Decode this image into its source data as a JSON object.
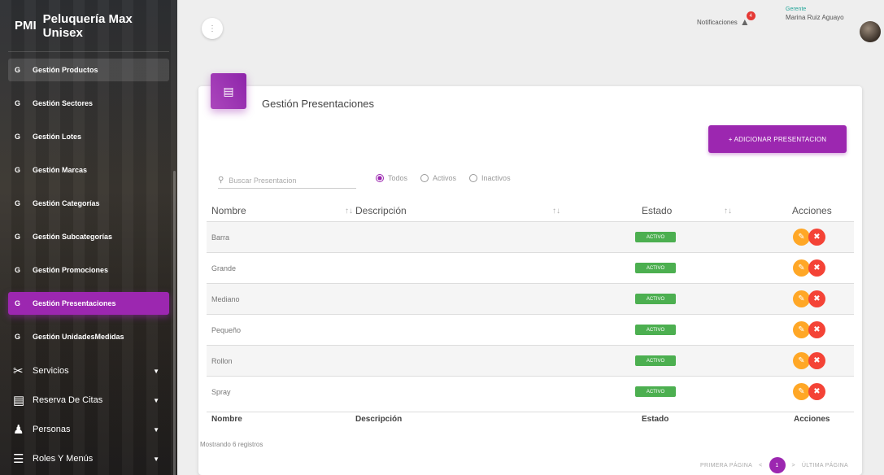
{
  "brand": {
    "abbr": "PMI",
    "name": "Peluquería Max Unisex"
  },
  "menu": [
    {
      "icon": "G",
      "label": "Gestión Productos",
      "state": "selected"
    },
    {
      "icon": "G",
      "label": "Gestión Sectores",
      "state": ""
    },
    {
      "icon": "G",
      "label": "Gestión Lotes",
      "state": ""
    },
    {
      "icon": "G",
      "label": "Gestión Marcas",
      "state": ""
    },
    {
      "icon": "G",
      "label": "Gestión Categorías",
      "state": ""
    },
    {
      "icon": "G",
      "label": "Gestión Subcategorías",
      "state": ""
    },
    {
      "icon": "G",
      "label": "Gestión Promociones",
      "state": ""
    },
    {
      "icon": "G",
      "label": "Gestión Presentaciones",
      "state": "active"
    },
    {
      "icon": "G",
      "label": "Gestión UnidadesMedidas",
      "state": ""
    }
  ],
  "groups": [
    {
      "icon": "scissors-icon",
      "label": "Servicios"
    },
    {
      "icon": "list-icon",
      "label": "Reserva De Citas"
    },
    {
      "icon": "person-icon",
      "label": "Personas"
    },
    {
      "icon": "menu-icon",
      "label": "Roles Y Menús"
    }
  ],
  "topbar": {
    "notifications_label": "Notificaciones",
    "notifications_count": "4",
    "user_role": "Gerente",
    "user_name": "Marina Ruiz Aguayo"
  },
  "card": {
    "title": "Gestión Presentaciones",
    "add_button": "+ ADICIONAR PRESENTACION",
    "search_placeholder": "Buscar Presentacion",
    "filters": [
      {
        "label": "Todos",
        "selected": true
      },
      {
        "label": "Activos",
        "selected": false
      },
      {
        "label": "Inactivos",
        "selected": false
      }
    ]
  },
  "table": {
    "headers": {
      "nombre": "Nombre",
      "descripcion": "Descripción",
      "estado": "Estado",
      "acciones": "Acciones"
    },
    "rows": [
      {
        "nombre": "Barra",
        "estado": "ACTIVO"
      },
      {
        "nombre": "Grande",
        "estado": "ACTIVO"
      },
      {
        "nombre": "Mediano",
        "estado": "ACTIVO"
      },
      {
        "nombre": "Pequeño",
        "estado": "ACTIVO"
      },
      {
        "nombre": "Rollon",
        "estado": "ACTIVO"
      },
      {
        "nombre": "Spray",
        "estado": "ACTIVO"
      }
    ],
    "footer": {
      "nombre": "Nombre",
      "descripcion": "Descripción",
      "estado": "Estado",
      "acciones": "Acciones"
    },
    "showing": "Mostrando 6 registros"
  },
  "pager": {
    "first": "PRIMERA PÁGINA",
    "prev": "<",
    "current": "1",
    "next": ">",
    "last": "ÚLTIMA PÁGINA"
  },
  "colors": {
    "accent": "#9c27b0",
    "status_active": "#4caf50",
    "edit": "#ffa726",
    "delete": "#f44336"
  }
}
